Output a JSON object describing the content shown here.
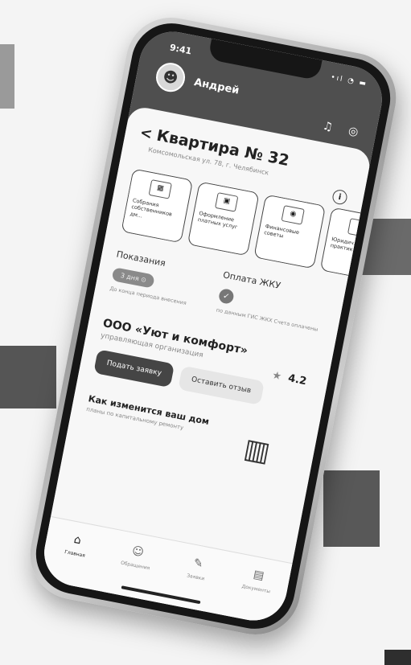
{
  "status": {
    "time": "9:41",
    "indicators": "•ıl ◔ ▬"
  },
  "user": {
    "name": "Андрей",
    "avatar_icon": "user-avatar-icon"
  },
  "header_actions": [
    "bell-icon",
    "headset-icon"
  ],
  "apartment": {
    "back_glyph": "<",
    "title": "Квартира № 32",
    "address": "Комсомольская ул. 78, г. Челябинск"
  },
  "info_glyph": "i",
  "tiles": [
    {
      "icon": "calendar-icon",
      "label": "Собрания собственников дм..."
    },
    {
      "icon": "services-icon",
      "label": "Оформление платных услуг"
    },
    {
      "icon": "finance-icon",
      "label": "Финансовые советы"
    },
    {
      "icon": "legal-icon",
      "label": "Юридич... практик..."
    }
  ],
  "readings": {
    "title": "Показания",
    "pill": "3 дня ⊙",
    "note": "До конца периода внесения"
  },
  "payment": {
    "title": "Оплата ЖКУ",
    "check_glyph": "✓",
    "note": "по данным ГИС ЖКХ Счета оплачены"
  },
  "organization": {
    "name": "ООО «Уют и комфорт»",
    "type": "управляющая организация",
    "rating": "4.2",
    "star_glyph": "★",
    "submit_label": "Подать заявку",
    "review_label": "Оставить отзыв"
  },
  "promo": {
    "title": "Как изменится ваш дом",
    "subtitle": "планы по капитальному ремонту",
    "icon": "building-repair-icon"
  },
  "bottom_nav": [
    {
      "icon": "home-icon",
      "glyph": "⌂",
      "label": "Главная",
      "active": true
    },
    {
      "icon": "chat-icon",
      "glyph": "☺",
      "label": "Обращения",
      "active": false
    },
    {
      "icon": "pencil-icon",
      "glyph": "✎",
      "label": "Заявки",
      "active": false
    },
    {
      "icon": "document-icon",
      "glyph": "▤",
      "label": "Документы",
      "active": false
    }
  ],
  "colors": {
    "header": "#4f4f4f",
    "accent_dark": "#454545"
  }
}
